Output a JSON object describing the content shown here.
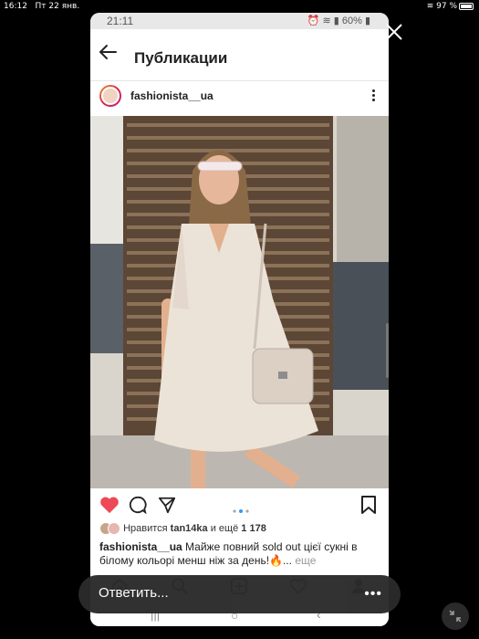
{
  "ipad_status": {
    "time": "16:12",
    "date": "Пт 22 янв.",
    "battery": "97 %"
  },
  "phone_status": {
    "time": "21:11",
    "battery": "60%"
  },
  "header": {
    "title": "Публикации"
  },
  "post": {
    "username": "fashionista__ua",
    "likes_prefix": "Нравится",
    "likes_user": "tan14ka",
    "likes_mid": "и ещё",
    "likes_count": "1 178",
    "caption_user": "fashionista__ua",
    "caption_text": "Майже повний sold out цієї сукні в білому кольорі менш ніж за день!🔥...",
    "caption_more": "еще"
  },
  "reply": {
    "label": "Ответить...",
    "more": "•••"
  },
  "colors": {
    "like": "#ed4956",
    "dots_active": "#3897f0"
  },
  "icons": [
    "back-arrow-icon",
    "more-vertical-icon",
    "heart-icon",
    "comment-icon",
    "share-icon",
    "bookmark-icon",
    "home-icon",
    "search-icon",
    "add-post-icon",
    "activity-heart-icon",
    "profile-icon",
    "close-icon",
    "minimize-icon"
  ]
}
